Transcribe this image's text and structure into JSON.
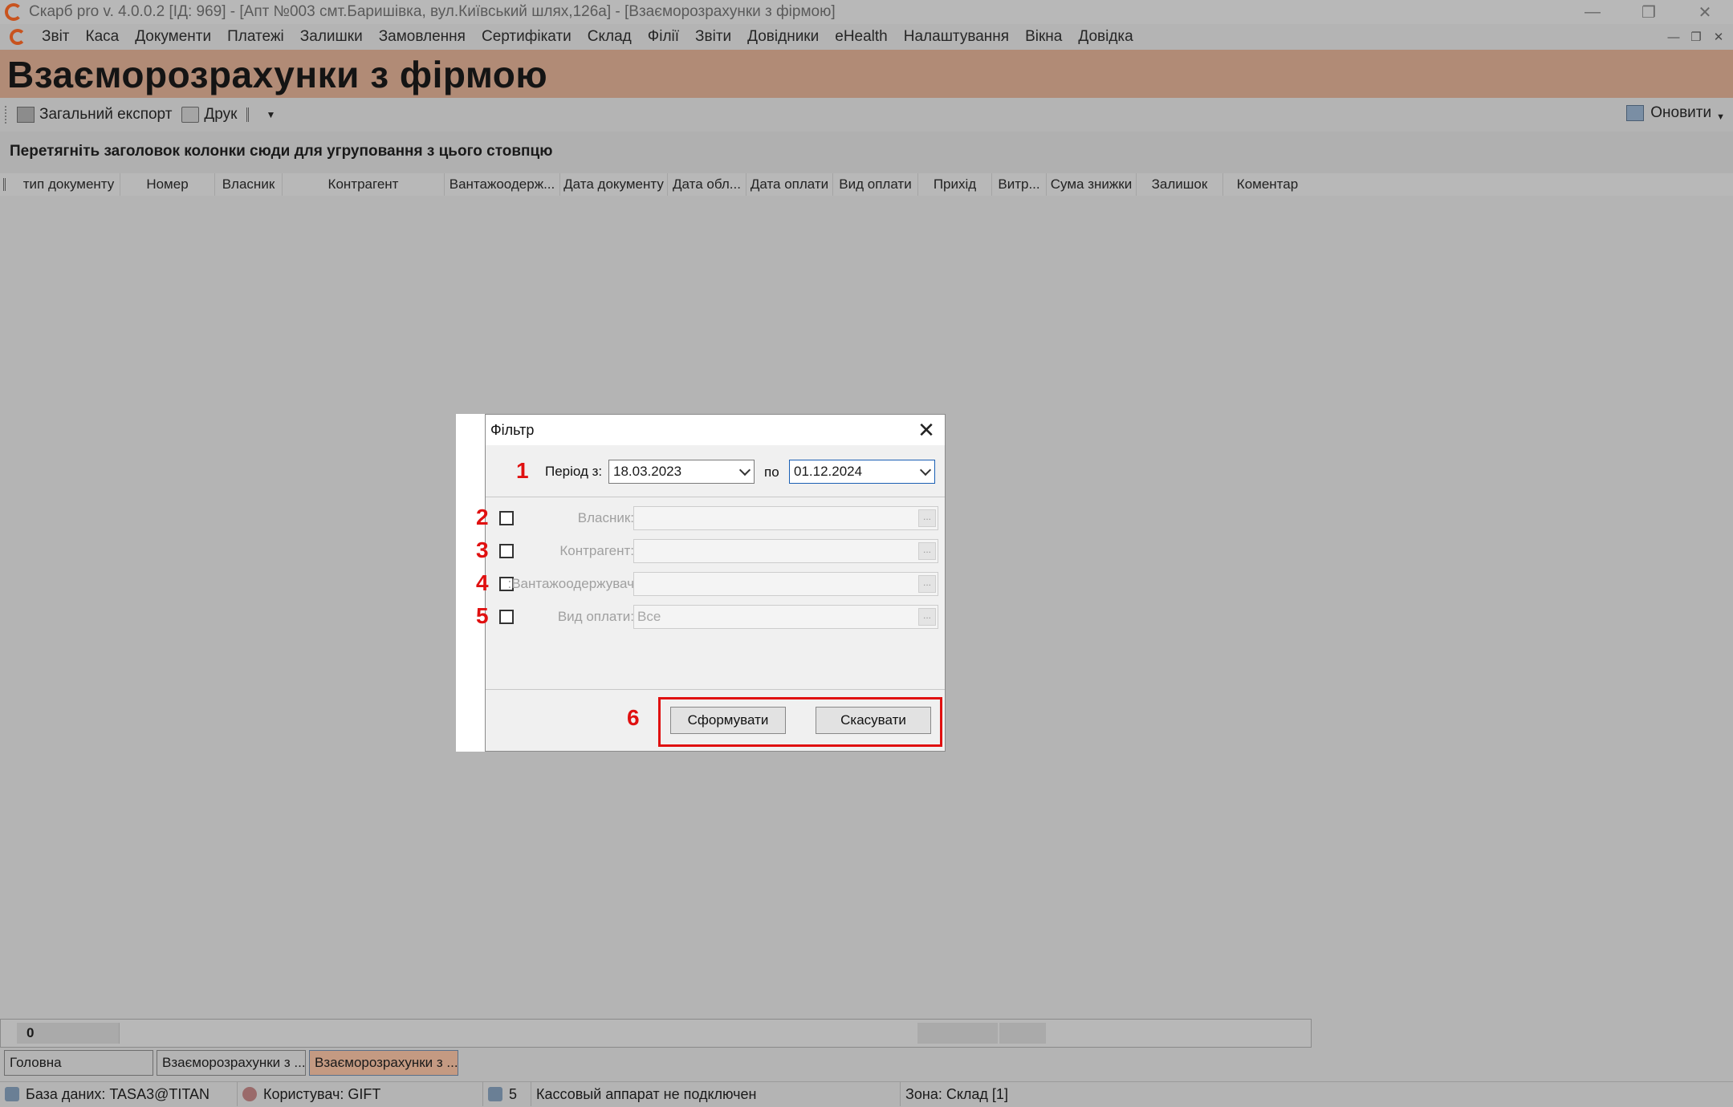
{
  "window": {
    "title": "Скарб pro v. 4.0.0.2 [ІД: 969] - [Апт №003 смт.Баришівка, вул.Київський шлях,126а] - [Взаєморозрахунки з фірмою]",
    "minimize_icon": "minimize-icon",
    "restore_icon": "restore-icon",
    "close_icon": "close-icon"
  },
  "menu": {
    "items": [
      "Звіт",
      "Каса",
      "Документи",
      "Платежі",
      "Залишки",
      "Замовлення",
      "Сертифікати",
      "Склад",
      "Філії",
      "Звіти",
      "Довідники",
      "eHealth",
      "Налаштування",
      "Вікна",
      "Довідка"
    ]
  },
  "page": {
    "title": "Взаєморозрахунки з фірмою"
  },
  "toolbar": {
    "export_label": "Загальний експорт",
    "print_label": "Друк",
    "refresh_label": "Оновити"
  },
  "grid": {
    "group_hint": "Перетягніть заголовок колонки сюди для угруповання з цього стовпцю",
    "columns": [
      "тип документу",
      "Номер",
      "Власник",
      "Контрагент",
      "Вантажоодерж...",
      "Дата документу",
      "Дата обл...",
      "Дата оплати",
      "Вид оплати",
      "Прихід",
      "Витр...",
      "Сума знижки",
      "Залишок",
      "Коментар"
    ],
    "row_count": "0"
  },
  "dialog": {
    "title": "Фільтр",
    "period_from_label": "Період з:",
    "period_from_value": "18.03.2023",
    "period_to_label": "по",
    "period_to_value": "01.12.2024",
    "owner_label": "Власник:",
    "owner_value": "",
    "counterparty_label": "Контрагент:",
    "counterparty_value": "",
    "consignee_label": "Вантажоодержувач:",
    "consignee_value": "",
    "payment_type_label": "Вид оплати:",
    "payment_type_value": "Все",
    "ellipsis": "...",
    "generate_button": "Сформувати",
    "cancel_button": "Скасувати"
  },
  "annotations": {
    "n1": "1",
    "n2": "2",
    "n3": "3",
    "n4": "4",
    "n5": "5",
    "n6": "6",
    "color": "#e01010"
  },
  "window_tabs": [
    "Головна",
    "Взаєморозрахунки з ...",
    "Взаєморозрахунки з ..."
  ],
  "status": {
    "database": "База даних: TASA3@TITAN",
    "user": "Користувач: GIFT",
    "cash_count": "5",
    "cash_status": "Кассовый аппарат не подключен",
    "zone": "Зона: Склад [1]"
  },
  "colors": {
    "banner": "#b18b76",
    "active_tab": "#c49a82",
    "background": "#b4b4b4"
  }
}
